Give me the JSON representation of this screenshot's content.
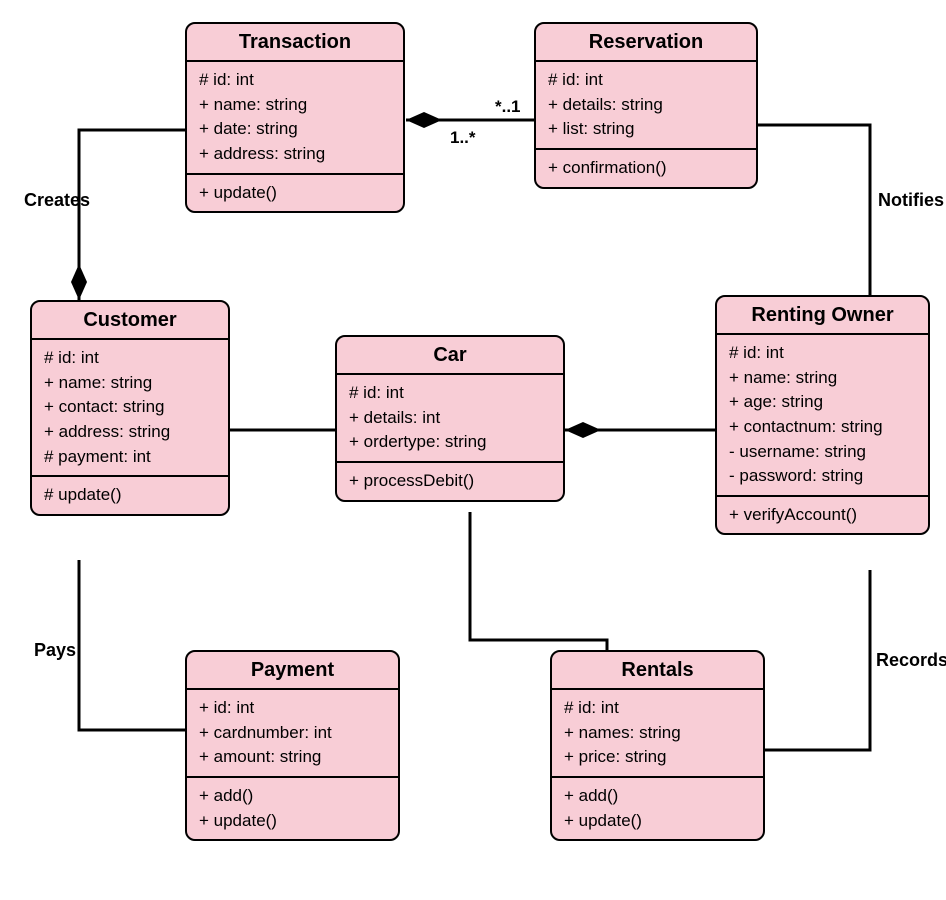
{
  "diagram_type": "UML Class Diagram",
  "classes": {
    "transaction": {
      "name": "Transaction",
      "attributes": [
        "# id: int",
        "+ name: string",
        "+ date: string",
        "+ address: string"
      ],
      "methods": [
        "+ update()"
      ]
    },
    "reservation": {
      "name": "Reservation",
      "attributes": [
        "# id: int",
        "+ details: string",
        "+ list: string"
      ],
      "methods": [
        "+ confirmation()"
      ]
    },
    "customer": {
      "name": "Customer",
      "attributes": [
        "# id: int",
        "+ name: string",
        "+ contact: string",
        "+ address: string",
        "# payment: int"
      ],
      "methods": [
        "# update()"
      ]
    },
    "car": {
      "name": "Car",
      "attributes": [
        "# id: int",
        "+ details: int",
        "+ ordertype: string"
      ],
      "methods": [
        "+ processDebit()"
      ]
    },
    "rentingOwner": {
      "name": "Renting Owner",
      "attributes": [
        "# id: int",
        "+ name: string",
        "+ age: string",
        "+ contactnum: string",
        "- username: string",
        "- password: string"
      ],
      "methods": [
        "+ verifyAccount()"
      ]
    },
    "payment": {
      "name": "Payment",
      "attributes": [
        "+ id: int",
        "+ cardnumber: int",
        "+ amount: string"
      ],
      "methods": [
        "+ add()",
        "+ update()"
      ]
    },
    "rentals": {
      "name": "Rentals",
      "attributes": [
        "# id: int",
        "+ names: string",
        "+ price: string"
      ],
      "methods": [
        "+ add()",
        "+ update()"
      ]
    }
  },
  "relationships": {
    "creates": {
      "label": "Creates",
      "from": "Customer",
      "to": "Transaction",
      "type": "composition"
    },
    "notifies": {
      "label": "Notifies",
      "from": "Reservation",
      "to": "Renting Owner",
      "type": "association"
    },
    "pays": {
      "label": "Pays",
      "from": "Customer",
      "to": "Payment",
      "type": "association"
    },
    "records": {
      "label": "Records",
      "from": "Renting Owner",
      "to": "Rentals",
      "type": "association"
    },
    "trans_res": {
      "from": "Transaction",
      "to": "Reservation",
      "type": "composition",
      "mult_from": "1..*",
      "mult_to": "*..1"
    },
    "cust_car": {
      "from": "Customer",
      "to": "Car",
      "type": "association"
    },
    "car_owner": {
      "from": "Car",
      "to": "Renting Owner",
      "type": "composition"
    },
    "car_rentals": {
      "from": "Car",
      "to": "Rentals",
      "type": "aggregation"
    }
  }
}
